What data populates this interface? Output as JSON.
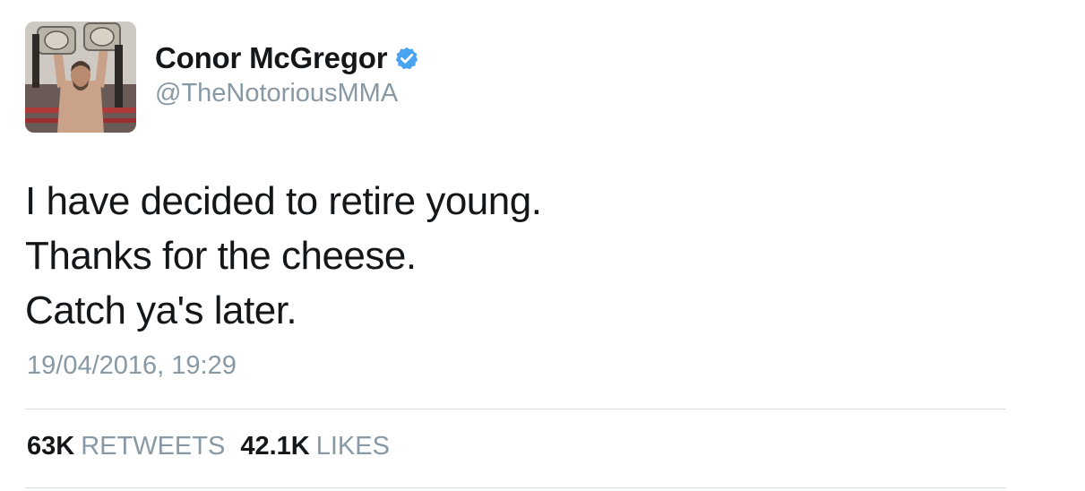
{
  "tweet": {
    "author": {
      "display_name": "Conor McGregor",
      "handle": "@TheNotoriousMMA",
      "verified": true,
      "verified_icon": "verified-badge-icon",
      "verified_color": "#4aa3f0"
    },
    "text_lines": [
      "I have decided to retire young.",
      "Thanks for the cheese.",
      "Catch ya's later."
    ],
    "timestamp": "19/04/2016, 19:29",
    "stats": {
      "retweets_count": "63K",
      "retweets_label": "RETWEETS",
      "likes_count": "42.1K",
      "likes_label": "LIKES"
    }
  },
  "colors": {
    "text_primary": "#14171a",
    "text_secondary": "#8899a6",
    "divider": "#d8dde2"
  }
}
